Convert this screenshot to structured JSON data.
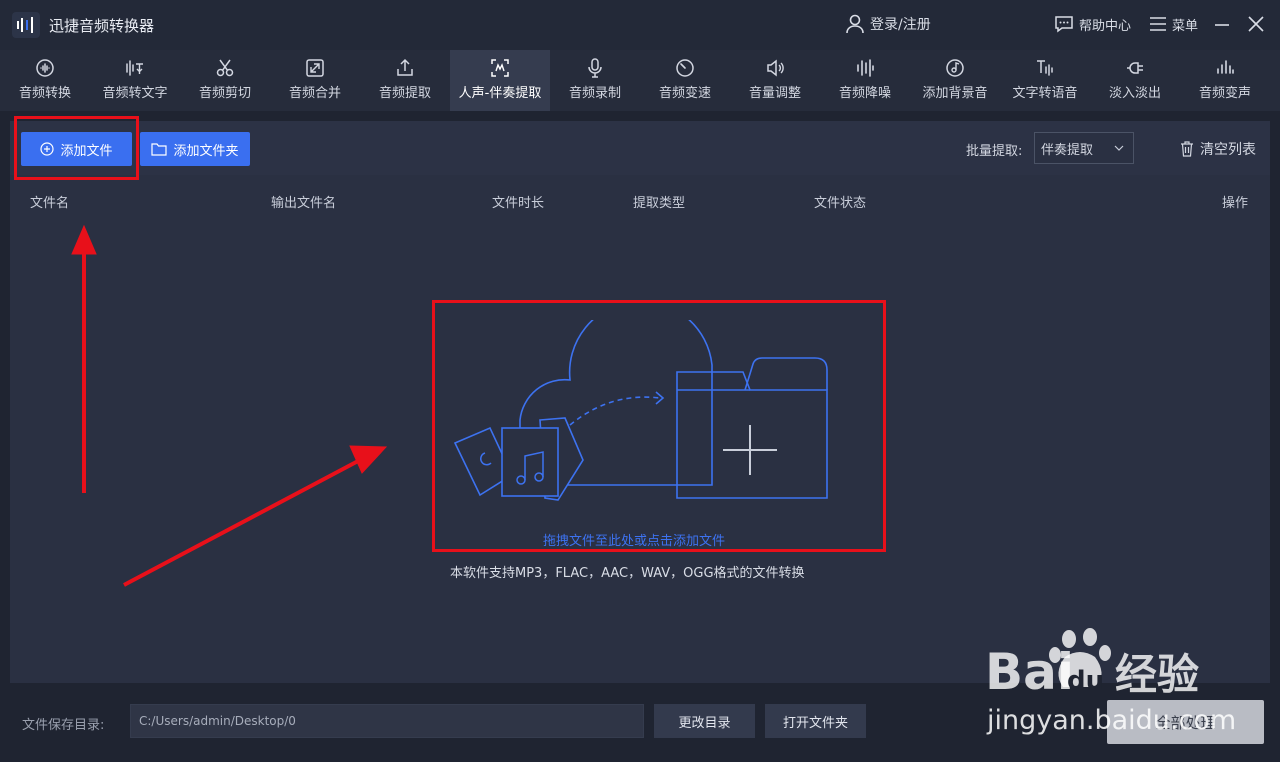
{
  "app": {
    "title": "迅捷音频转换器"
  },
  "header": {
    "login": "登录/注册",
    "help": "帮助中心",
    "menu": "菜单"
  },
  "toolbar": {
    "items": [
      {
        "label": "音频转换",
        "icon": "waveform-circle-icon"
      },
      {
        "label": "音频转文字",
        "icon": "voice-to-text-icon"
      },
      {
        "label": "音频剪切",
        "icon": "scissors-icon"
      },
      {
        "label": "音频合并",
        "icon": "merge-arrows-icon"
      },
      {
        "label": "音频提取",
        "icon": "upload-icon"
      },
      {
        "label": "人声-伴奏提取",
        "icon": "voice-extract-icon"
      },
      {
        "label": "音频录制",
        "icon": "microphone-icon"
      },
      {
        "label": "音频变速",
        "icon": "speedometer-icon"
      },
      {
        "label": "音量调整",
        "icon": "speaker-icon"
      },
      {
        "label": "音频降噪",
        "icon": "equalizer-bars-icon"
      },
      {
        "label": "添加背景音",
        "icon": "music-disc-icon"
      },
      {
        "label": "文字转语音",
        "icon": "text-to-speech-icon"
      },
      {
        "label": "淡入淡出",
        "icon": "fade-icon"
      },
      {
        "label": "音频变声",
        "icon": "voice-bars-icon"
      }
    ],
    "active_index": 5
  },
  "actions": {
    "add_file": "添加文件",
    "add_folder": "添加文件夹",
    "batch_label": "批量提取:",
    "batch_value": "伴奏提取",
    "clear_list": "清空列表"
  },
  "table": {
    "columns": [
      "文件名",
      "输出文件名",
      "文件时长",
      "提取类型",
      "文件状态",
      "操作"
    ]
  },
  "dropzone": {
    "hint": "拖拽文件至此处或点击添加文件",
    "support": "本软件支持MP3，FLAC，AAC，WAV，OGG格式的文件转换"
  },
  "footer": {
    "save_label": "文件保存目录:",
    "save_path": "C:/Users/admin/Desktop/0",
    "change_dir": "更改目录",
    "open_folder": "打开文件夹",
    "process_all": "全部处理"
  },
  "watermark": {
    "brand": "Bai",
    "brand_du": "du",
    "brand_suffix": "经验",
    "url": "jingyan.baidu.com"
  },
  "colors": {
    "accent": "#3a6ff0",
    "annotation": "#e8101a",
    "background": "#1f2431",
    "panel": "#2a3042"
  }
}
